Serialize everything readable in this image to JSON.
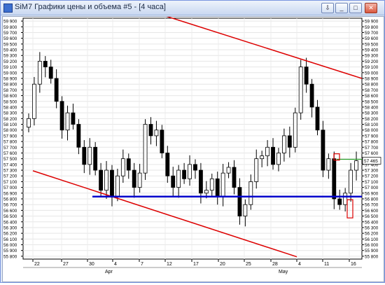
{
  "window": {
    "title": "SiM7 Графики цены и объема #5 - [4 часа]",
    "buttons": {
      "pin": "⇩",
      "minimize": "_",
      "maximize": "□",
      "close": "✕"
    }
  },
  "chart_data": {
    "type": "candlestick",
    "instrument": "SiM7",
    "timeframe": "4 часа",
    "y_ticks": [
      "59 900",
      "59 800",
      "59 700",
      "59 600",
      "59 500",
      "59 400",
      "59 300",
      "59 200",
      "59 100",
      "59 000",
      "58 900",
      "58 800",
      "58 700",
      "58 600",
      "58 500",
      "58 400",
      "58 300",
      "58 200",
      "58 100",
      "58 000",
      "57 900",
      "57 800",
      "57 700",
      "57 600",
      "57 500",
      "57 400",
      "57 300",
      "57 200",
      "57 100",
      "57 000",
      "56 900",
      "56 800",
      "56 700",
      "56 600",
      "56 500",
      "56 400",
      "56 300",
      "56 200",
      "56 100",
      "56 000",
      "55 900",
      "55 800"
    ],
    "ylim": [
      55750,
      59950
    ],
    "x_ticks": [
      "22",
      "27",
      "30",
      "4",
      "7",
      "12",
      "17",
      "20",
      "25",
      "28",
      "4",
      "11",
      "16"
    ],
    "month_labels": [
      "Apr",
      "May"
    ],
    "last_price_label": "57 465",
    "last_price": 57465,
    "horizontal_lines": [
      {
        "name": "support",
        "value": 56840,
        "color": "#0000cc"
      },
      {
        "name": "last",
        "value": 57490,
        "color": "#2ca02c"
      }
    ],
    "trend_lines": [
      {
        "color": "#dd0000",
        "from": {
          "date": "Apr 5",
          "value": 59990
        },
        "to": {
          "date": "May 17",
          "value": 58900
        }
      },
      {
        "color": "#dd0000",
        "from": {
          "date": "Mar 22",
          "value": 57290
        },
        "to": {
          "date": "May 8",
          "value": 55790
        }
      }
    ],
    "close_series": [
      58200,
      58800,
      59200,
      59100,
      58900,
      58500,
      58000,
      58300,
      58100,
      57700,
      57400,
      57700,
      57300,
      56950,
      57300,
      56850,
      57200,
      57500,
      57300,
      57000,
      57250,
      58100,
      57900,
      58000,
      57600,
      57200,
      57000,
      57300,
      57150,
      57400,
      57300,
      56900,
      56950,
      57150,
      56850,
      57250,
      57350,
      57000,
      56500,
      56700,
      57100,
      57500,
      57550,
      57700,
      57400,
      57600,
      57900,
      57700,
      58300,
      59100,
      58800,
      58400,
      58000,
      57300,
      57500,
      56800,
      56700,
      56900,
      57300,
      57465
    ],
    "annotations": [
      {
        "type": "box",
        "color": "#dd0000",
        "at_value": 57500
      },
      {
        "type": "box",
        "color": "#dd0000",
        "at_value": 56700
      }
    ]
  }
}
